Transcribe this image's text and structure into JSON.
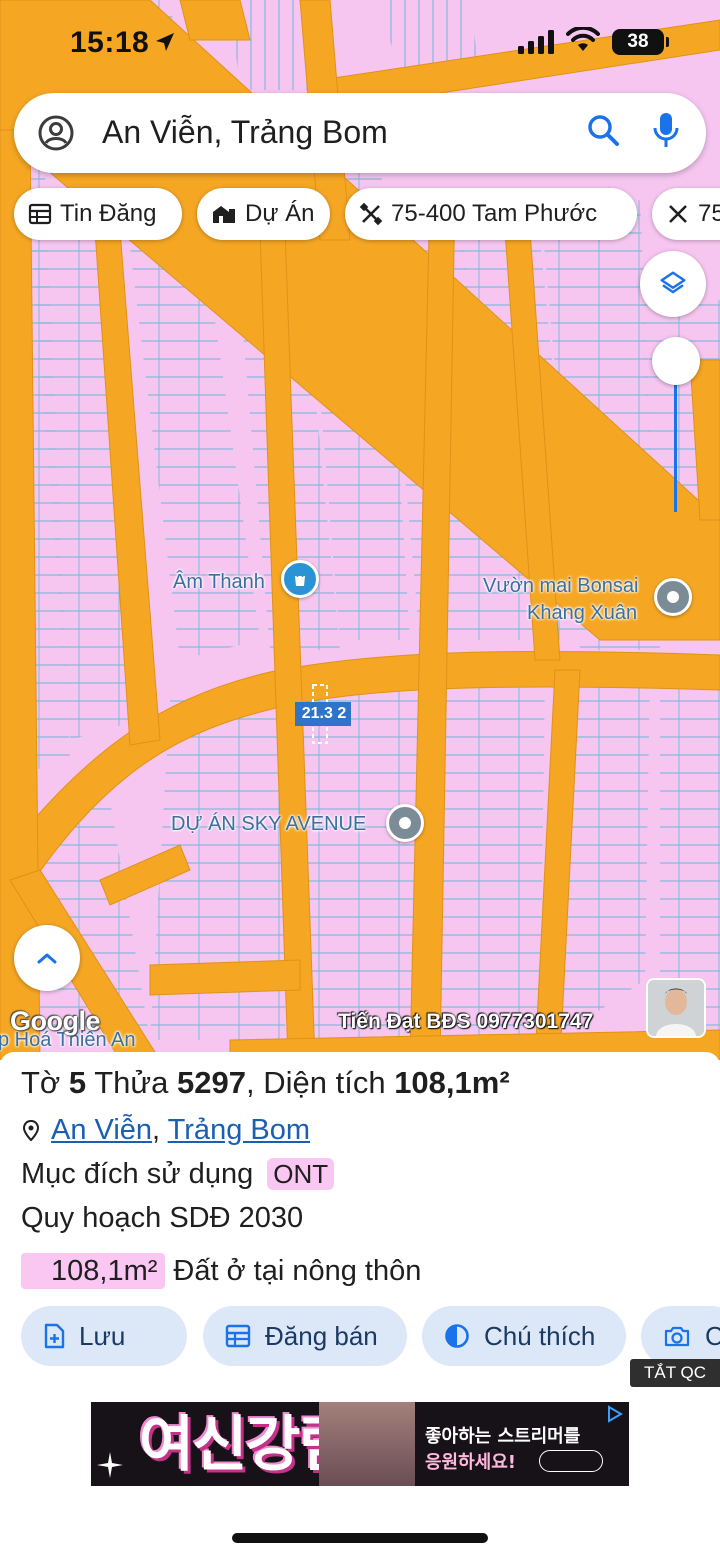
{
  "status_bar": {
    "time": "15:18",
    "battery": "38"
  },
  "search": {
    "query": "An Viễn, Trảng Bom"
  },
  "chips": [
    {
      "label": "Tin Đăng",
      "icon": "table-icon"
    },
    {
      "label": "Dự Án",
      "icon": "building-icon"
    },
    {
      "label": "75-400 Tam Phước",
      "icon": "crossed-tools-icon"
    },
    {
      "label": "75",
      "icon": "crossed-tools-icon"
    }
  ],
  "map": {
    "labels": {
      "am_thanh": "Âm Thanh",
      "vuon_mai_1": "Vườn mai Bonsai",
      "vuon_mai_2": "Khang Xuân",
      "sky_avenue": "DỰ ÁN SKY AVENUE",
      "thien_an": "p Hoá Thiên An",
      "parcel_dims": "21.3 2"
    },
    "google_logo": "Google",
    "watermark": "Tiến Đạt BĐS 0977301747",
    "colors": {
      "land": "#f6c6f0",
      "road": "#f5a623",
      "parcel_line": "#79b7d9"
    }
  },
  "parcel": {
    "to_label": "Tờ",
    "to_value": "5",
    "thua_label": "Thửa",
    "thua_value": "5297",
    "area_label": "Diện tích",
    "area_value": "108,1m²",
    "location_ward": "An Viễn",
    "location_district": "Trảng Bom",
    "purpose_label": "Mục đích sử dụng",
    "purpose_code": "ONT",
    "plan_label": "Quy hoạch SDĐ 2030",
    "plan_area": "108,1m²",
    "plan_desc": "Đất ở tại nông thôn"
  },
  "actions": [
    {
      "label": "Lưu",
      "icon": "save-doc-icon"
    },
    {
      "label": "Đăng bán",
      "icon": "table-icon"
    },
    {
      "label": "Chú thích",
      "icon": "contrast-icon"
    },
    {
      "label": "C",
      "icon": "camera-icon"
    }
  ],
  "ad": {
    "close_label": "TẮT QC",
    "headline": "여신강림",
    "line1": "좋아하는 스트리머를",
    "line2": "응원하세요!"
  }
}
